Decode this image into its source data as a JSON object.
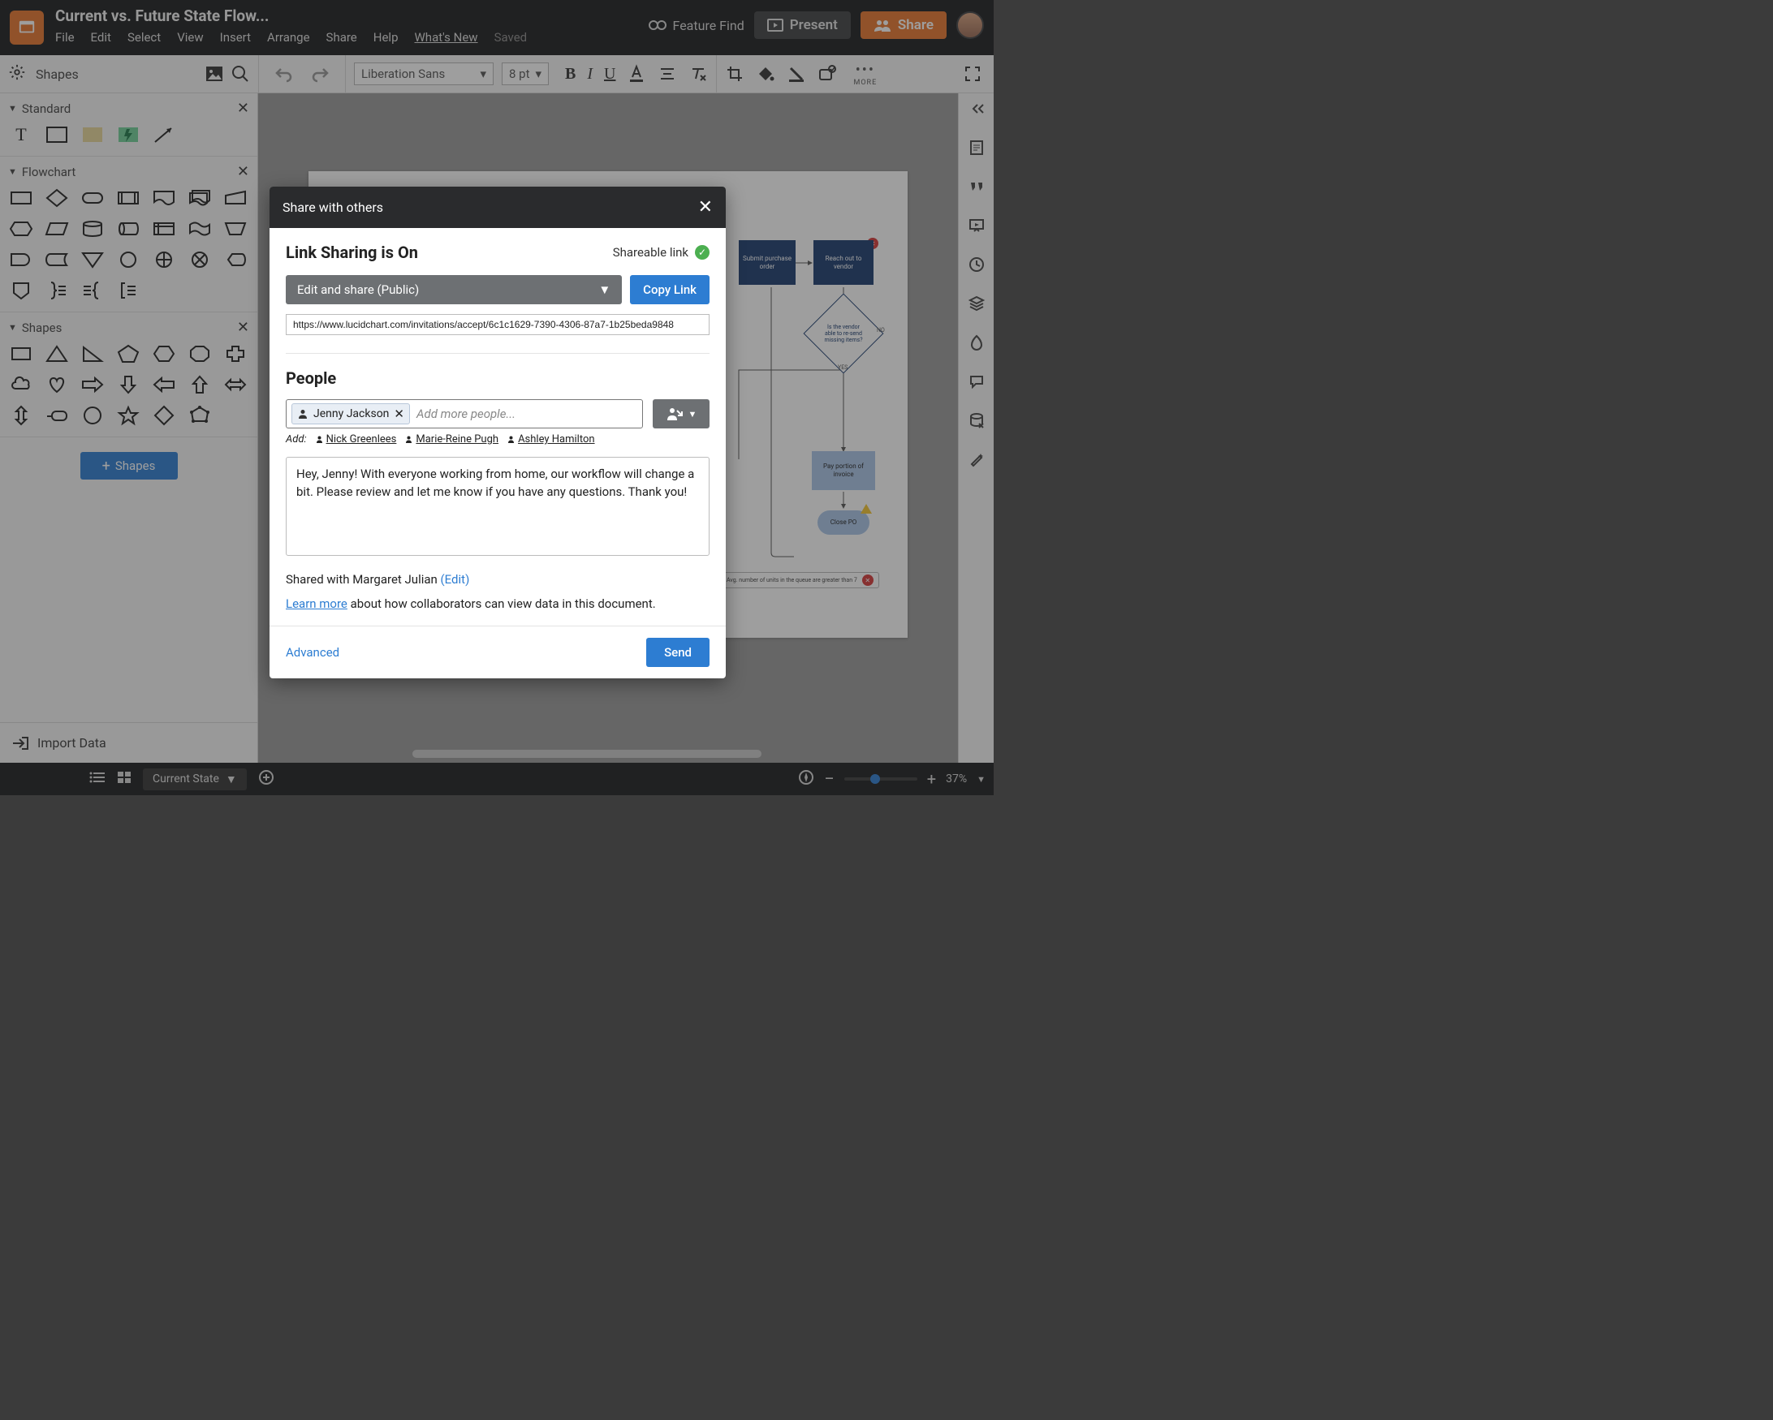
{
  "header": {
    "doc_title": "Current vs. Future State Flow...",
    "menu": {
      "file": "File",
      "edit": "Edit",
      "select": "Select",
      "view": "View",
      "insert": "Insert",
      "arrange": "Arrange",
      "share": "Share",
      "help": "Help",
      "whatsnew": "What's New",
      "saved": "Saved"
    },
    "feature_find": "Feature Find",
    "present": "Present",
    "share_btn": "Share"
  },
  "formatbar": {
    "shapes_label": "Shapes",
    "font_name": "Liberation Sans",
    "font_size": "8 pt",
    "more": "MORE"
  },
  "shape_panel": {
    "g1": "Standard",
    "g2": "Flowchart",
    "g3": "Shapes",
    "add_btn": "Shapes",
    "import": "Import Data"
  },
  "flow": {
    "n1": "Submit purchase order",
    "n2": "Reach out to vendor",
    "n3": "Is the vendor able to re-send missing items?",
    "n4": "Pay portion of invoice",
    "n5": "Close PO",
    "no": "NO",
    "yes": "YES",
    "anno": "Avg. number of units in the queue are greater than 7"
  },
  "statusbar": {
    "page": "Current State",
    "zoom": "37%"
  },
  "modal": {
    "title": "Share with others",
    "link_title": "Link Sharing is On",
    "shareable": "Shareable link",
    "perm": "Edit and share (Public)",
    "copy": "Copy Link",
    "url": "https://www.lucidchart.com/invitations/accept/6c1c1629-7390-4306-87a7-1b25beda9848",
    "people_title": "People",
    "chip_name": "Jenny Jackson",
    "placeholder": "Add more people...",
    "add_label": "Add:",
    "sug1": "Nick Greenlees",
    "sug2": "Marie-Reine Pugh",
    "sug3": "Ashley Hamilton",
    "message": "Hey, Jenny! With everyone working from home, our workflow will change a bit. Please review and let me know if you have any questions. Thank you!",
    "shared_with": "Shared with Margaret Julian ",
    "edit_link": "(Edit)",
    "learn_link": "Learn more",
    "learn_rest": " about how collaborators can view data in this document.",
    "advanced": "Advanced",
    "send": "Send"
  }
}
